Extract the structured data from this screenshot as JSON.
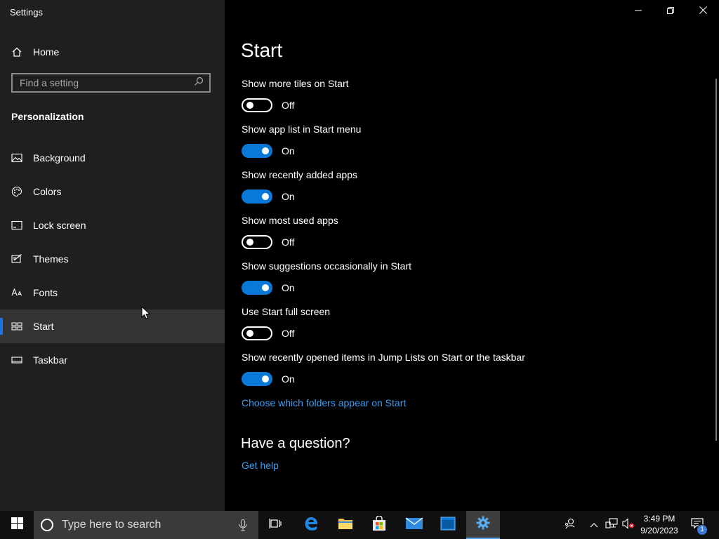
{
  "window": {
    "title": "Settings"
  },
  "sidebar": {
    "home_label": "Home",
    "search_placeholder": "Find a setting",
    "section": "Personalization",
    "items": [
      {
        "label": "Background",
        "icon": "picture-icon"
      },
      {
        "label": "Colors",
        "icon": "palette-icon"
      },
      {
        "label": "Lock screen",
        "icon": "lock-screen-icon"
      },
      {
        "label": "Themes",
        "icon": "themes-icon"
      },
      {
        "label": "Fonts",
        "icon": "fonts-icon"
      },
      {
        "label": "Start",
        "icon": "start-layout-icon",
        "active": true
      },
      {
        "label": "Taskbar",
        "icon": "taskbar-icon"
      }
    ]
  },
  "main": {
    "title": "Start",
    "settings": [
      {
        "label": "Show more tiles on Start",
        "on": false,
        "state": "Off"
      },
      {
        "label": "Show app list in Start menu",
        "on": true,
        "state": "On"
      },
      {
        "label": "Show recently added apps",
        "on": true,
        "state": "On"
      },
      {
        "label": "Show most used apps",
        "on": false,
        "state": "Off"
      },
      {
        "label": "Show suggestions occasionally in Start",
        "on": true,
        "state": "On"
      },
      {
        "label": "Use Start full screen",
        "on": false,
        "state": "Off"
      },
      {
        "label": "Show recently opened items in Jump Lists on Start or the taskbar",
        "on": true,
        "state": "On"
      }
    ],
    "folders_link": "Choose which folders appear on Start",
    "question_title": "Have a question?",
    "help_link": "Get help"
  },
  "taskbar": {
    "search_placeholder": "Type here to search",
    "clock_time": "3:49 PM",
    "clock_date": "9/20/2023",
    "notification_count": "1",
    "accent_color": "#0a78d7"
  }
}
